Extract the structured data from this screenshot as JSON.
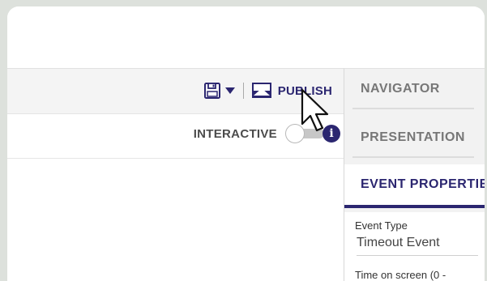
{
  "toolbar": {
    "publish_label": "PUBLISH",
    "icons": [
      "save-icon",
      "dropdown-arrow-icon",
      "publish-monitor-icon"
    ]
  },
  "interactive": {
    "label": "INTERACTIVE",
    "toggle_on": false,
    "info_glyph": "i"
  },
  "panel": {
    "tabs": [
      {
        "label": "NAVIGATOR",
        "active": false
      },
      {
        "label": "PRESENTATION",
        "active": false
      },
      {
        "label": "EVENT PROPERTIES",
        "active": true
      }
    ],
    "fields": {
      "event_type_label": "Event Type",
      "event_type_value": "Timeout Event",
      "time_on_screen_label": "Time on screen (0 -"
    }
  },
  "colors": {
    "accent": "#2b2670",
    "background": "#dde1dc"
  }
}
